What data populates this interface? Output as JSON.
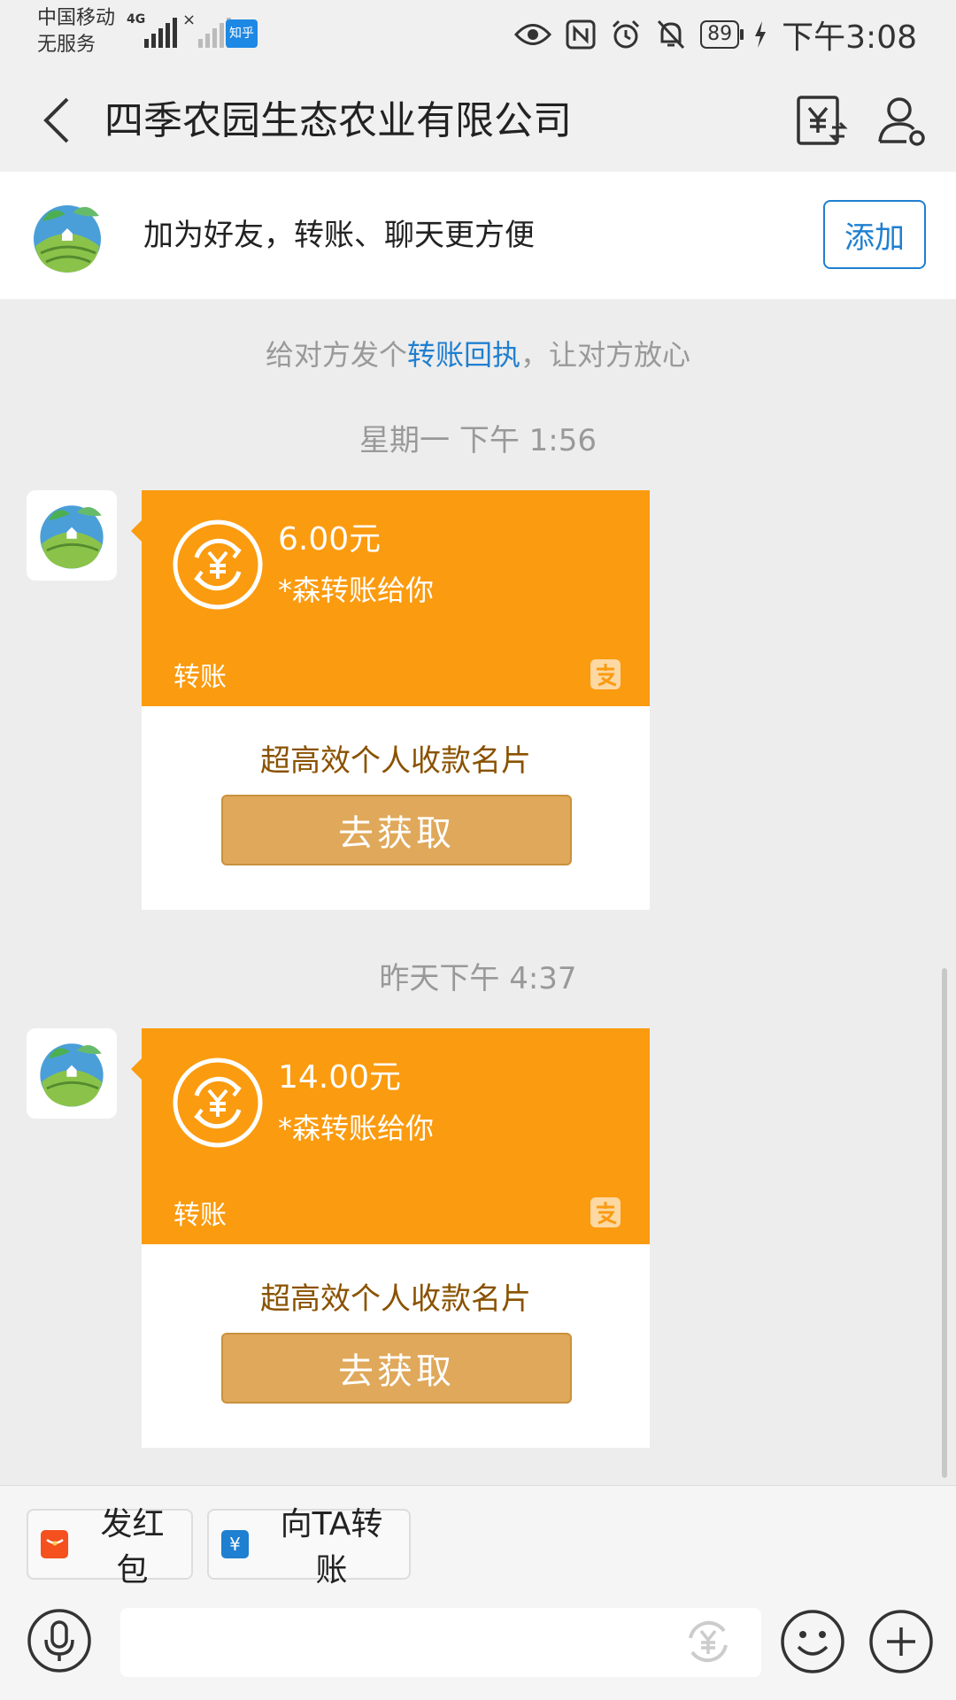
{
  "status_bar": {
    "carrier_line1": "中国移动",
    "carrier_line2": "无服务",
    "network": "4G",
    "app_badge": "知乎",
    "battery": "89",
    "time": "下午3:08",
    "icons": [
      "eye-icon",
      "nfc-icon",
      "alarm-icon",
      "mute-icon",
      "battery-icon",
      "charging-icon"
    ]
  },
  "header": {
    "title": "四季农园生态农业有限公司"
  },
  "banner": {
    "text": "加为好友，转账、聊天更方便",
    "add_label": "添加"
  },
  "tip": {
    "prefix": "给对方发个",
    "link": "转账回执",
    "suffix": "，让对方放心"
  },
  "messages": [
    {
      "time": "星期一 下午 1:56",
      "amount": "6.00元",
      "from": "*森转账给你",
      "label": "转账",
      "promo": "超高效个人收款名片",
      "action": "去获取"
    },
    {
      "time": "昨天下午 4:37",
      "amount": "14.00元",
      "from": "*森转账给你",
      "label": "转账",
      "promo": "超高效个人收款名片",
      "action": "去获取"
    }
  ],
  "bottom": {
    "red_packet_label": "发红包",
    "transfer_label": "向TA转账"
  },
  "colors": {
    "accent_blue": "#1f7fd0",
    "card_orange": "#fb9b0f",
    "button_gold": "#e0a85a",
    "red_packet": "#f4511e"
  }
}
